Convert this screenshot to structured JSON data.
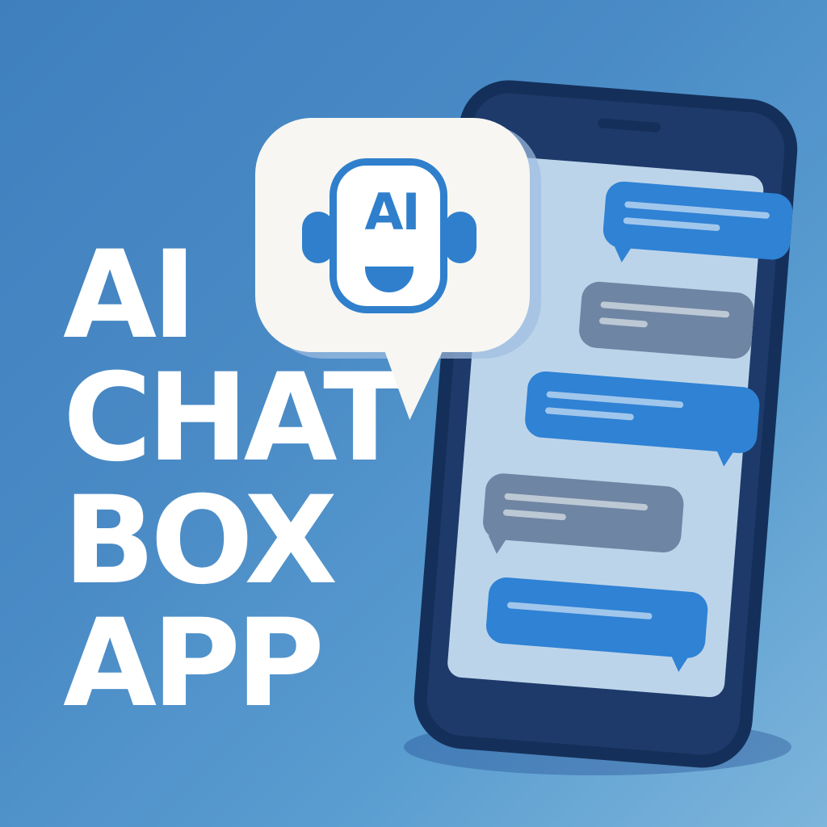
{
  "headline": {
    "line1": "AI",
    "line2": "CHAT",
    "line3": "BOX",
    "line4": "APP"
  },
  "logo": {
    "badge_text": "AI",
    "icon": "robot-headset-icon"
  },
  "colors": {
    "background": "#4a8bc6",
    "phone_frame": "#14305a",
    "screen": "#bcd4ea",
    "ai_message": "#2f82d4",
    "user_message": "#6e85a3",
    "accent": "#2f7fcc",
    "bubble": "#f7f6f2"
  },
  "chat": {
    "messages": [
      {
        "sender": "ai"
      },
      {
        "sender": "user"
      },
      {
        "sender": "ai"
      },
      {
        "sender": "user"
      },
      {
        "sender": "ai"
      }
    ]
  }
}
